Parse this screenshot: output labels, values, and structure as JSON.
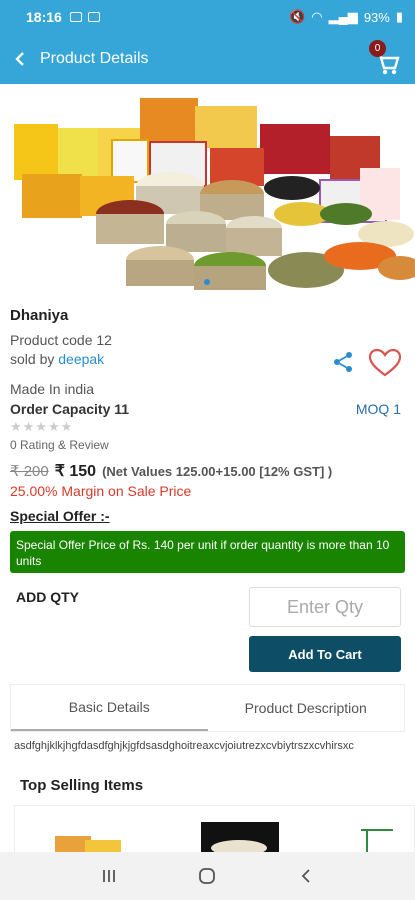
{
  "status": {
    "time": "18:16",
    "battery": "93%"
  },
  "header": {
    "title": "Product Details",
    "cart_count": "0"
  },
  "product": {
    "name": "Dhaniya",
    "code": "Product code 12",
    "sold_by_prefix": "sold by ",
    "seller": "deepak",
    "made_in": "Made In india",
    "order_capacity": "Order Capacity 11",
    "moq": "MOQ 1",
    "stars": "★★★★★",
    "rating_text": "0 Rating & Review",
    "mrp": "₹ 200",
    "price": "₹ 150",
    "net_values": "(Net Values 125.00+15.00 [12% GST] )",
    "margin": "25.00% Margin on Sale Price"
  },
  "offer": {
    "heading": "Special Offer :-",
    "text": "Special Offer Price of Rs. 140 per unit if order quantity is more than 10 units"
  },
  "purchase": {
    "add_qty_label": "ADD QTY",
    "qty_placeholder": "Enter Qty",
    "add_to_cart_label": "Add To Cart"
  },
  "tabs": [
    {
      "label": "Basic Details",
      "active": true
    },
    {
      "label": "Product Description",
      "active": false
    }
  ],
  "details_text": "asdfghjklkjhgfdasdfghjkjgfdsasdghoitreaxcvjoiutrezxcvbiytrszxcvhirsxc",
  "top_selling": {
    "heading": "Top Selling Items"
  },
  "colors": {
    "primary": "#36a5d8",
    "button": "#0e4d66",
    "offer": "#198400",
    "margin": "#d63a2a",
    "heart": "#d9534f"
  }
}
